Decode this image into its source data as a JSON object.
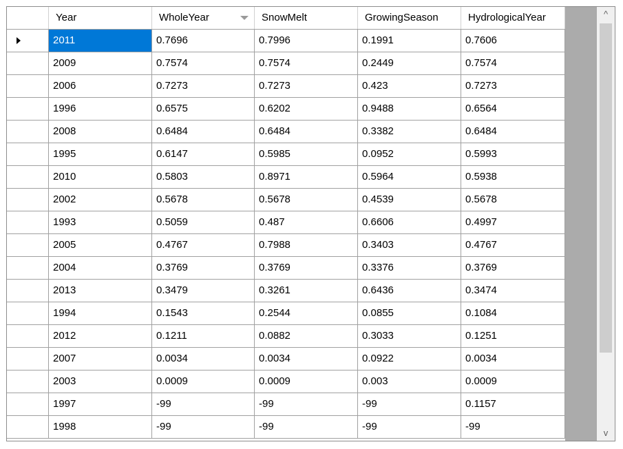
{
  "columns": [
    "Year",
    "WholeYear",
    "SnowMelt",
    "GrowingSeason",
    "HydrologicalYear"
  ],
  "sort_icon": "sort-down-icon",
  "selected_row": 0,
  "rows": [
    [
      "2011",
      "0.7696",
      "0.7996",
      "0.1991",
      "0.7606"
    ],
    [
      "2009",
      "0.7574",
      "0.7574",
      "0.2449",
      "0.7574"
    ],
    [
      "2006",
      "0.7273",
      "0.7273",
      "0.423",
      "0.7273"
    ],
    [
      "1996",
      "0.6575",
      "0.6202",
      "0.9488",
      "0.6564"
    ],
    [
      "2008",
      "0.6484",
      "0.6484",
      "0.3382",
      "0.6484"
    ],
    [
      "1995",
      "0.6147",
      "0.5985",
      "0.0952",
      "0.5993"
    ],
    [
      "2010",
      "0.5803",
      "0.8971",
      "0.5964",
      "0.5938"
    ],
    [
      "2002",
      "0.5678",
      "0.5678",
      "0.4539",
      "0.5678"
    ],
    [
      "1993",
      "0.5059",
      "0.487",
      "0.6606",
      "0.4997"
    ],
    [
      "2005",
      "0.4767",
      "0.7988",
      "0.3403",
      "0.4767"
    ],
    [
      "2004",
      "0.3769",
      "0.3769",
      "0.3376",
      "0.3769"
    ],
    [
      "2013",
      "0.3479",
      "0.3261",
      "0.6436",
      "0.3474"
    ],
    [
      "1994",
      "0.1543",
      "0.2544",
      "0.0855",
      "0.1084"
    ],
    [
      "2012",
      "0.1211",
      "0.0882",
      "0.3033",
      "0.1251"
    ],
    [
      "2007",
      "0.0034",
      "0.0034",
      "0.0922",
      "0.0034"
    ],
    [
      "2003",
      "0.0009",
      "0.0009",
      "0.003",
      "0.0009"
    ],
    [
      "1997",
      "-99",
      "-99",
      "-99",
      "0.1157"
    ],
    [
      "1998",
      "-99",
      "-99",
      "-99",
      "-99"
    ]
  ],
  "scrollbar": {
    "up_glyph": "^",
    "down_glyph": "v"
  }
}
